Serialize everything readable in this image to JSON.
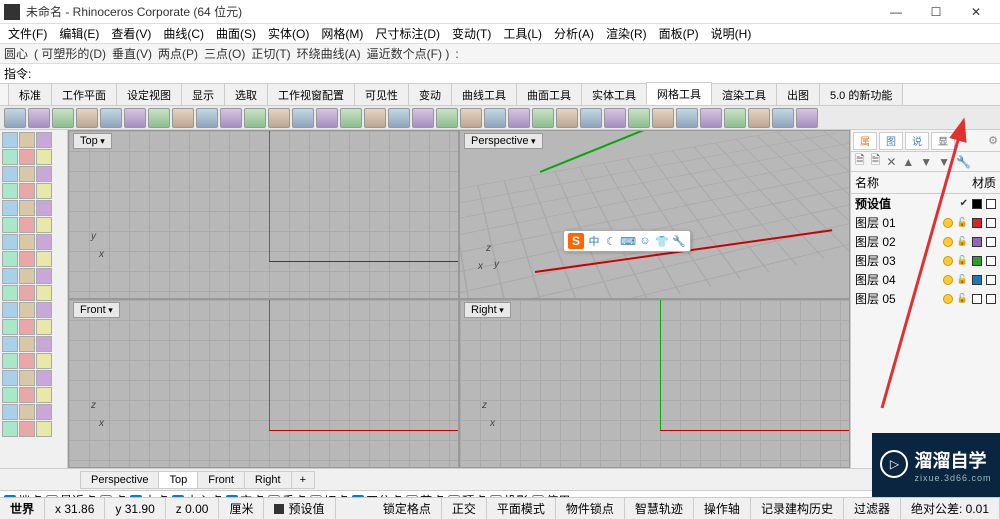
{
  "window": {
    "title": "未命名 - Rhinoceros Corporate (64 位元)"
  },
  "menus": [
    "文件(F)",
    "编辑(E)",
    "查看(V)",
    "曲线(C)",
    "曲面(S)",
    "实体(O)",
    "网格(M)",
    "尺寸标注(D)",
    "变动(T)",
    "工具(L)",
    "分析(A)",
    "渲染(R)",
    "面板(P)",
    "说明(H)"
  ],
  "opts": {
    "pfx": "圆心",
    "items": [
      "( 可塑形的(D)",
      "垂直(V)",
      "两点(P)",
      "三点(O)",
      "正切(T)",
      "环绕曲线(A)",
      "逼近数个点(F) )",
      ":"
    ]
  },
  "command_label": "指令:",
  "tabs": [
    "标准",
    "工作平面",
    "设定视图",
    "显示",
    "选取",
    "工作视窗配置",
    "可见性",
    "变动",
    "曲线工具",
    "曲面工具",
    "实体工具",
    "网格工具",
    "渲染工具",
    "出图",
    "5.0 的新功能"
  ],
  "active_tab": "网格工具",
  "viewports": {
    "tl": "Top",
    "tr": "Perspective",
    "bl": "Front",
    "br": "Right"
  },
  "rp_tabs": [
    {
      "t": "属",
      "c": "#e67e22"
    },
    {
      "t": "图",
      "c": "#4a7fb8"
    },
    {
      "t": "说",
      "c": "#4a7fb8"
    },
    {
      "t": "显",
      "c": "#666"
    }
  ],
  "rp_header": {
    "name": "名称",
    "mat": "材质"
  },
  "layers": [
    {
      "name": "预设值",
      "bold": true,
      "check": true,
      "color": "#000000"
    },
    {
      "name": "图层 01",
      "color": "#d62728"
    },
    {
      "name": "图层 02",
      "color": "#9467bd"
    },
    {
      "name": "图层 03",
      "color": "#2ca02c"
    },
    {
      "name": "图层 04",
      "color": "#1f77b4"
    },
    {
      "name": "图层 05",
      "color": "#ffffff"
    }
  ],
  "vp_tabs": [
    "Perspective",
    "Top",
    "Front",
    "Right"
  ],
  "active_vp_tab": "Top",
  "osnaps": [
    {
      "l": "端点",
      "c": true
    },
    {
      "l": "最近点",
      "c": false
    },
    {
      "l": "点",
      "c": false
    },
    {
      "l": "中点",
      "c": true
    },
    {
      "l": "中心点",
      "c": true
    },
    {
      "l": "交点",
      "c": true
    },
    {
      "l": "垂点",
      "c": false
    },
    {
      "l": "切点",
      "c": false
    },
    {
      "l": "四分点",
      "c": true
    },
    {
      "l": "节点",
      "c": false
    },
    {
      "l": "顶点",
      "c": false
    },
    {
      "l": "投影",
      "c": false
    },
    {
      "l": "停用",
      "c": false
    }
  ],
  "status": {
    "world": "世界",
    "x": "x 31.86",
    "y": "y 31.90",
    "z": "z 0.00",
    "unit": "厘米",
    "layer": "预设值",
    "cells": [
      "锁定格点",
      "正交",
      "平面模式",
      "物件锁点",
      "智慧轨迹",
      "操作轴",
      "记录建构历史",
      "过滤器",
      "绝对公差: 0.01"
    ]
  },
  "toast": {
    "s": "S",
    "txt": "中"
  },
  "wm": {
    "big": "溜溜自学",
    "sm": "zixue.3d66.com"
  }
}
